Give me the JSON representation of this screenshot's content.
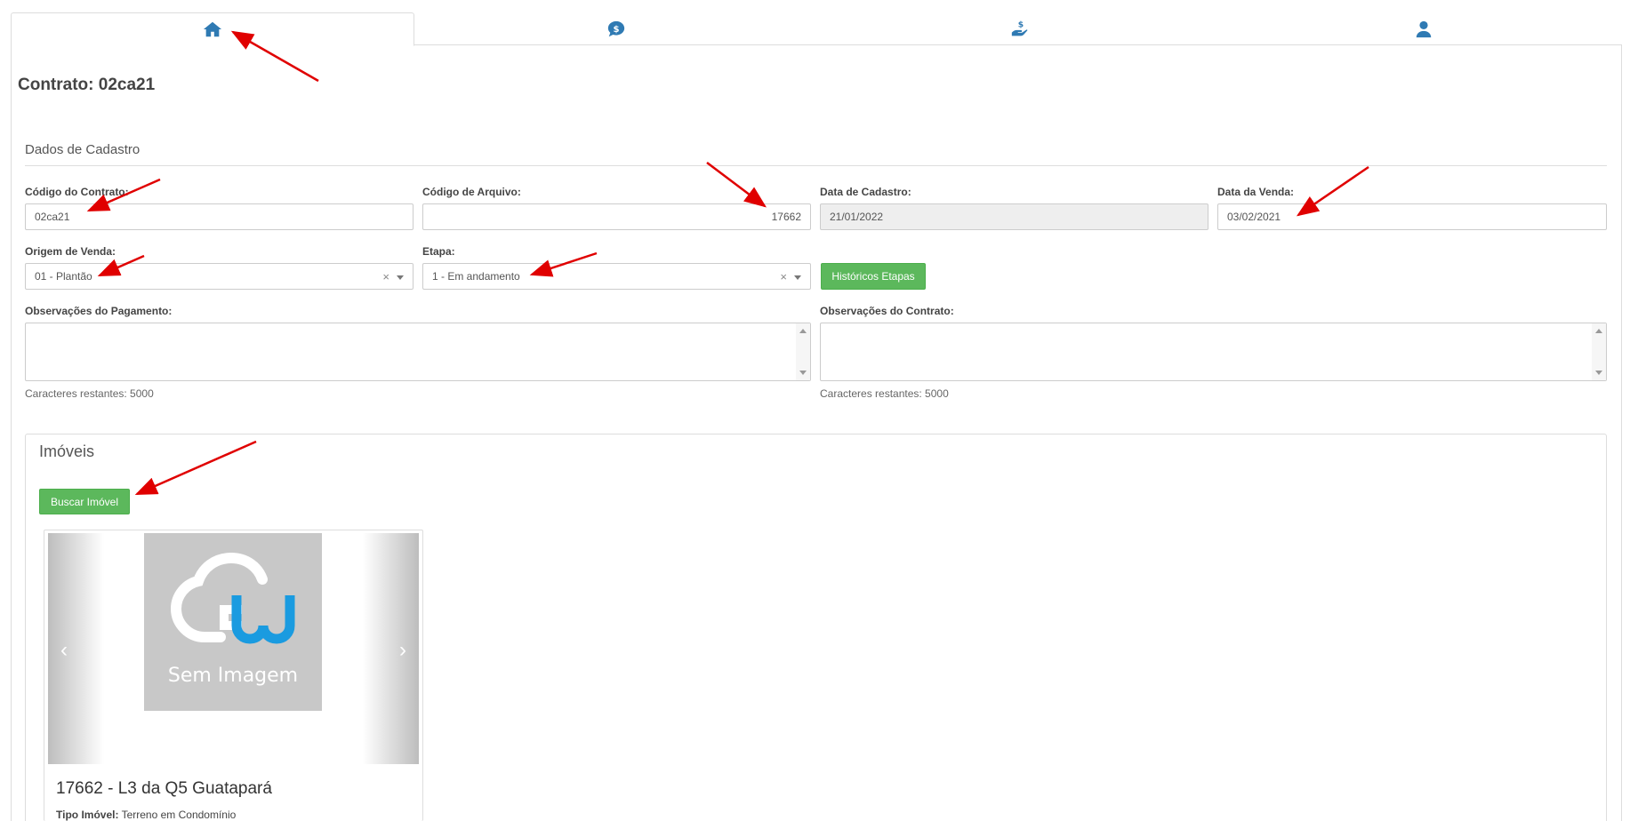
{
  "tabs": [
    {
      "icon": "home-icon",
      "active": true
    },
    {
      "icon": "money-bubble-icon",
      "active": false
    },
    {
      "icon": "hand-money-icon",
      "active": false
    },
    {
      "icon": "user-icon",
      "active": false
    }
  ],
  "page": {
    "title": "Contrato: 02ca21"
  },
  "section": {
    "title": "Dados de Cadastro"
  },
  "fields": {
    "codigo_contrato": {
      "label": "Código do Contrato:",
      "value": "02ca21"
    },
    "codigo_arquivo": {
      "label": "Código de Arquivo:",
      "value": "17662"
    },
    "data_cadastro": {
      "label": "Data de Cadastro:",
      "value": "21/01/2022"
    },
    "data_venda": {
      "label": "Data da Venda:",
      "value": "03/02/2021"
    },
    "origem_venda": {
      "label": "Origem de Venda:",
      "value": "01 - Plantão"
    },
    "etapa": {
      "label": "Etapa:",
      "value": "1 - Em andamento"
    },
    "obs_pagamento": {
      "label": "Observações do Pagamento:",
      "hint": "Caracteres restantes: 5000"
    },
    "obs_contrato": {
      "label": "Observações do Contrato:",
      "hint": "Caracteres restantes: 5000"
    }
  },
  "buttons": {
    "historicos": "Históricos Etapas",
    "buscar_imovel": "Buscar Imóvel"
  },
  "imoveis": {
    "title": "Imóveis",
    "card": {
      "image_text": "Sem Imagem",
      "title": "17662 - L3 da Q5 Guatapará",
      "tipo_label": "Tipo Imóvel:",
      "tipo_value": "Terreno em Condomínio"
    }
  },
  "colors": {
    "accent": "#2f7ab3",
    "success": "#5cb85c",
    "annotation": "#e00000"
  }
}
